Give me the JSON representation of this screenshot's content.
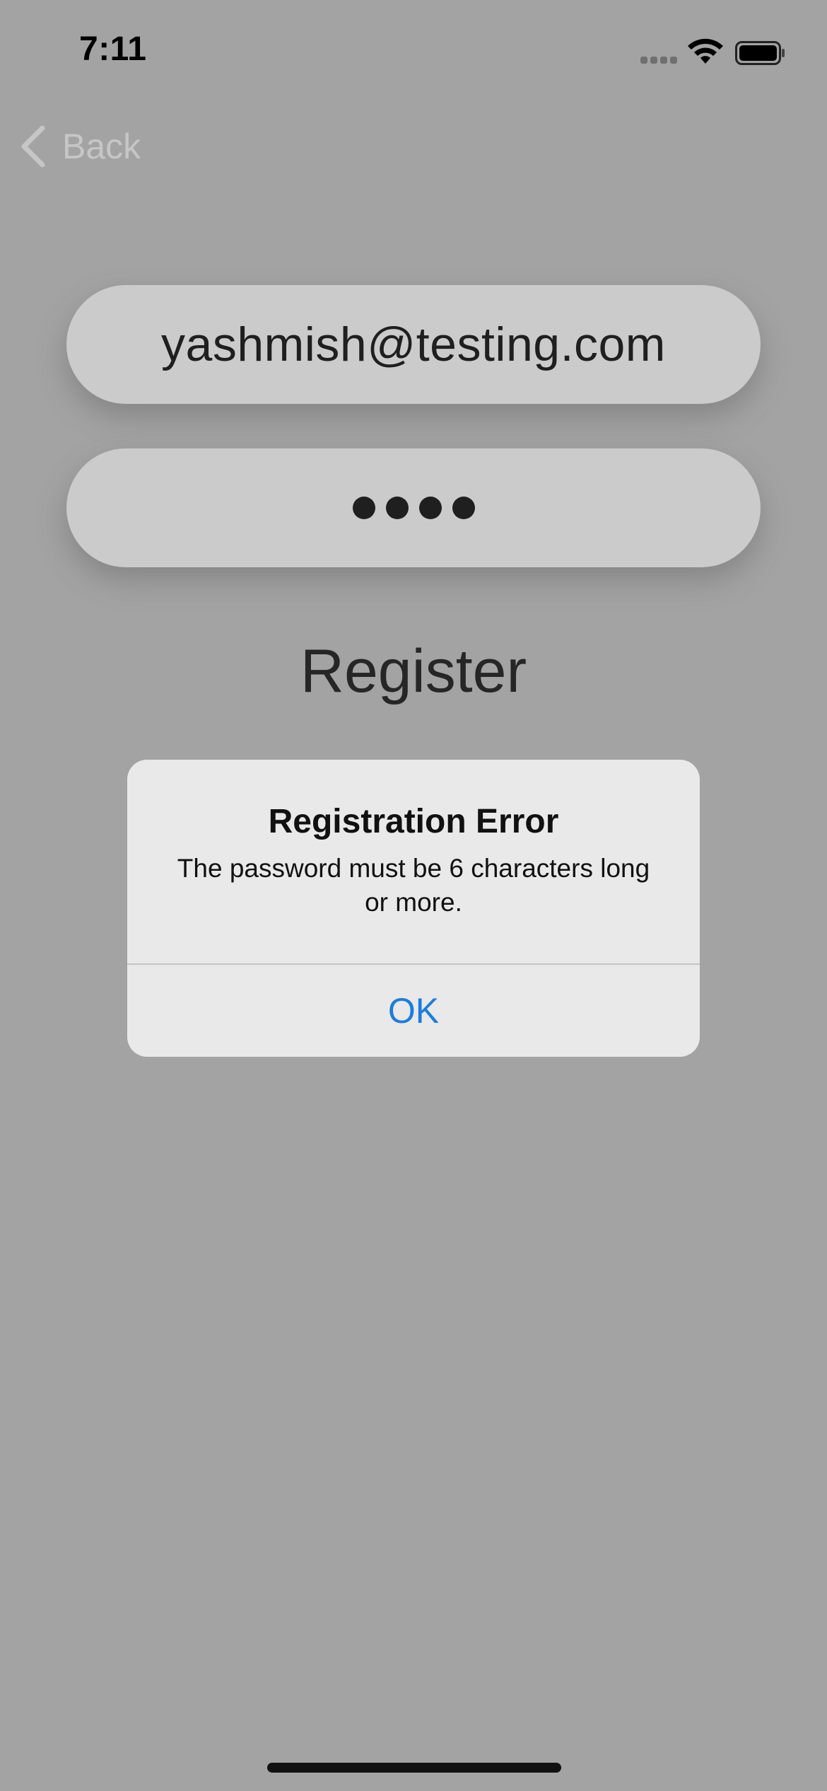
{
  "status_bar": {
    "time": "7:11",
    "signal_icon": "cellular-signal-icon",
    "wifi_icon": "wifi-icon",
    "battery_icon": "battery-icon"
  },
  "nav": {
    "back_label": "Back",
    "back_icon": "chevron-left-icon"
  },
  "form": {
    "email_value": "yashmish@testing.com",
    "password_mask": "••••",
    "register_label": "Register"
  },
  "alert": {
    "title": "Registration Error",
    "message": "The password must be 6 characters long or more.",
    "ok_label": "OK"
  },
  "colors": {
    "background": "#a3a3a3",
    "field": "#cbcbcb",
    "alert_background": "#e9e9e9",
    "accent": "#1a7de0"
  }
}
